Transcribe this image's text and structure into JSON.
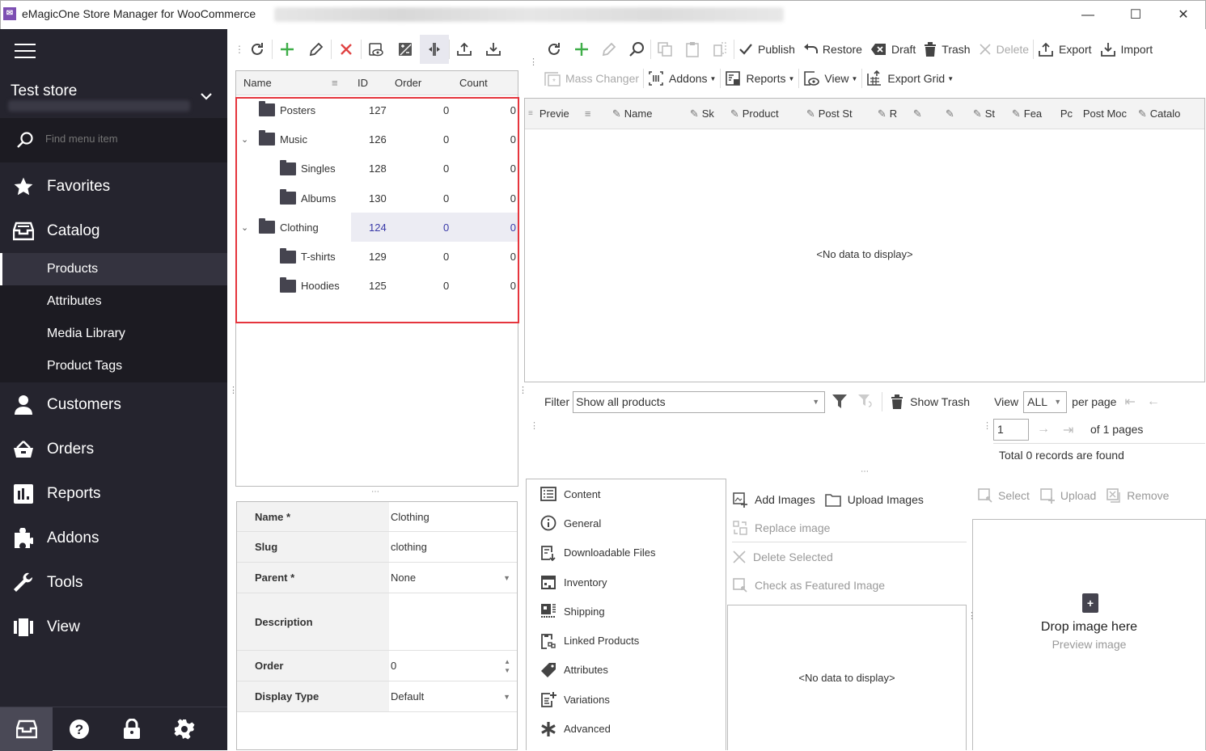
{
  "window": {
    "title": "eMagicOne Store Manager for WooCommerce",
    "app_icon": "emagicone-icon",
    "controls": {
      "minimize": "—",
      "maximize": "☐",
      "close": "✕"
    }
  },
  "sidebar": {
    "store_name": "Test store",
    "search_placeholder": "Find menu item",
    "items": [
      {
        "label": "Favorites",
        "icon": "star-icon"
      },
      {
        "label": "Catalog",
        "icon": "inbox-icon"
      },
      {
        "label": "Customers",
        "icon": "user-icon"
      },
      {
        "label": "Orders",
        "icon": "basket-icon"
      },
      {
        "label": "Reports",
        "icon": "bar-chart-icon"
      },
      {
        "label": "Addons",
        "icon": "puzzle-icon"
      },
      {
        "label": "Tools",
        "icon": "wrench-icon"
      },
      {
        "label": "View",
        "icon": "columns-icon"
      }
    ],
    "catalog_sub": [
      {
        "label": "Products",
        "active": true
      },
      {
        "label": "Attributes"
      },
      {
        "label": "Media Library"
      },
      {
        "label": "Product Tags"
      }
    ],
    "bottom": [
      "inbox-icon",
      "help-icon",
      "lock-icon",
      "gear-icon"
    ]
  },
  "category_tree": {
    "toolbar": [
      "refresh-icon",
      "add-icon",
      "edit-icon",
      "delete-icon",
      "preview-icon",
      "expand-collapse-icon",
      "split-icon",
      "export-icon",
      "import-icon"
    ],
    "columns": {
      "name": "Name",
      "id": "ID",
      "order": "Order",
      "count": "Count"
    },
    "rows": [
      {
        "name": "Posters",
        "id": "127",
        "order": "0",
        "count": "0",
        "level": 0,
        "expanded": null
      },
      {
        "name": "Music",
        "id": "126",
        "order": "0",
        "count": "0",
        "level": 0,
        "expanded": true
      },
      {
        "name": "Singles",
        "id": "128",
        "order": "0",
        "count": "0",
        "level": 1
      },
      {
        "name": "Albums",
        "id": "130",
        "order": "0",
        "count": "0",
        "level": 1
      },
      {
        "name": "Clothing",
        "id": "124",
        "order": "0",
        "count": "0",
        "level": 0,
        "expanded": true,
        "selected": true
      },
      {
        "name": "T-shirts",
        "id": "129",
        "order": "0",
        "count": "0",
        "level": 1
      },
      {
        "name": "Hoodies",
        "id": "125",
        "order": "0",
        "count": "0",
        "level": 1
      }
    ]
  },
  "category_form": {
    "fields": [
      {
        "label": "Name *",
        "value": "Clothing"
      },
      {
        "label": "Slug",
        "value": "clothing"
      },
      {
        "label": "Parent *",
        "value": "None",
        "type": "dropdown"
      },
      {
        "label": "Description",
        "value": ""
      },
      {
        "label": "Order",
        "value": "0",
        "type": "spinner"
      },
      {
        "label": "Display Type",
        "value": "Default",
        "type": "dropdown"
      }
    ]
  },
  "products_toolbar": {
    "row1": [
      {
        "label": "Publish",
        "icon": "check-icon"
      },
      {
        "label": "Restore",
        "icon": "undo-icon"
      },
      {
        "label": "Draft",
        "icon": "draft-icon"
      },
      {
        "label": "Trash",
        "icon": "trash-icon"
      },
      {
        "label": "Delete",
        "icon": "x-icon",
        "disabled": true
      },
      {
        "label": "Export",
        "icon": "export-icon"
      },
      {
        "label": "Import",
        "icon": "import-icon"
      }
    ],
    "row2": [
      {
        "label": "Mass Changer",
        "icon": "mass-changer-icon",
        "disabled": true
      },
      {
        "label": "Addons",
        "icon": "addons-icon",
        "dropdown": true
      },
      {
        "label": "Reports",
        "icon": "reports-icon",
        "dropdown": true
      },
      {
        "label": "View",
        "icon": "view-icon",
        "dropdown": true
      },
      {
        "label": "Export Grid",
        "icon": "export-grid-icon",
        "dropdown": true
      }
    ]
  },
  "products_grid": {
    "columns": [
      "Previe",
      "Name",
      "Sk",
      "Product",
      "Post St",
      "R",
      "",
      "",
      "St",
      "Fea",
      "Pc",
      "Post Moc",
      "Catalo"
    ],
    "empty_text": "<No data to display>"
  },
  "filter_bar": {
    "filter_label": "Filter",
    "filter_value": "Show all products",
    "show_trash": "Show Trash",
    "view_label": "View",
    "view_value": "ALL",
    "per_page": "per page",
    "page_value": "1",
    "of_pages": "of 1 pages",
    "total": "Total 0 records are found"
  },
  "product_tabs": [
    {
      "label": "Content",
      "icon": "list-icon"
    },
    {
      "label": "General",
      "icon": "info-icon"
    },
    {
      "label": "Downloadable Files",
      "icon": "download-file-icon"
    },
    {
      "label": "Inventory",
      "icon": "warehouse-icon"
    },
    {
      "label": "Shipping",
      "icon": "shipping-icon"
    },
    {
      "label": "Linked Products",
      "icon": "link-icon"
    },
    {
      "label": "Attributes",
      "icon": "tag-icon"
    },
    {
      "label": "Variations",
      "icon": "variations-icon"
    },
    {
      "label": "Advanced",
      "icon": "asterisk-icon"
    }
  ],
  "images": {
    "add_images": "Add Images",
    "upload_images": "Upload Images",
    "replace_image": "Replace image",
    "delete_selected": "Delete Selected",
    "check_featured": "Check as Featured Image",
    "empty_text": "<No data to display>"
  },
  "preview": {
    "select": "Select",
    "upload": "Upload",
    "remove": "Remove",
    "drop_title": "Drop image here",
    "drop_sub": "Preview image"
  },
  "colors": {
    "highlight_border": "#e5353d",
    "sidebar_bg": "#25242e",
    "add_green": "#3fae49",
    "delete_red": "#e04343"
  }
}
